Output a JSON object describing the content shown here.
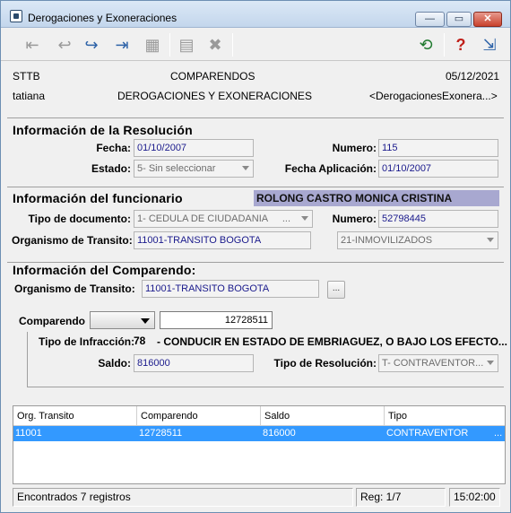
{
  "window": {
    "title": "Derogaciones y Exoneraciones"
  },
  "titlebar": {
    "minimize": "—",
    "maximize": "▭",
    "close": "✕"
  },
  "header": {
    "company": "STTB",
    "module": "COMPARENDOS",
    "date": "05/12/2021",
    "user": "tatiana",
    "form_title": "DEROGACIONES Y EXONERACIONES",
    "form_name": "<DerogacionesExonera...>"
  },
  "resolucion": {
    "title": "Información de la Resolución",
    "fecha_label": "Fecha:",
    "fecha": "01/10/2007",
    "numero_label": "Numero:",
    "numero": "115",
    "estado_label": "Estado:",
    "estado": "5- Sin seleccionar",
    "fecha_aplicacion_label": "Fecha Aplicación:",
    "fecha_aplicacion": "01/10/2007"
  },
  "funcionario": {
    "title": "Información del funcionario",
    "nombre": "ROLONG CASTRO MONICA CRISTINA",
    "tipo_doc_label": "Tipo de documento:",
    "tipo_doc": "1- CEDULA DE CIUDADANIA",
    "tipo_doc_dots": "...",
    "numero_label": "Numero:",
    "numero": "52798445",
    "organismo_label": "Organismo de Transito:",
    "organismo": "11001-TRANSITO BOGOTA",
    "inmovilizados": "21-INMOVILIZADOS"
  },
  "comparendo_info": {
    "title": "Información del Comparendo:",
    "organismo_label": "Organismo de Transito:",
    "organismo": "11001-TRANSITO BOGOTA",
    "lookup_button": "...",
    "comparendo_label": "Comparendo",
    "comparendo_value": "12728511",
    "tipo_infraccion_label": "Tipo de Infracción:",
    "tipo_infraccion_code": "78",
    "tipo_infraccion_desc": "- CONDUCIR EN ESTADO DE EMBRIAGUEZ, O BAJO LOS EFECTO...",
    "saldo_label": "Saldo:",
    "saldo": "816000",
    "tipo_resolucion_label": "Tipo de Resolución:",
    "tipo_resolucion": "T- CONTRAVENTOR..."
  },
  "grid": {
    "columns": [
      "Org. Transito",
      "Comparendo",
      "Saldo",
      "Tipo"
    ],
    "rows": [
      {
        "org": "11001",
        "comparendo": "12728511",
        "saldo": "816000",
        "tipo": "CONTRAVENTOR",
        "more": "..."
      }
    ]
  },
  "status": {
    "records": "Encontrados 7 registros",
    "reg": "Reg: 1/7",
    "time": "15:02:00"
  },
  "colors": {
    "selection": "#3399ff",
    "field_value": "#1a1a8c",
    "funcionario_highlight": "#a8a8d0"
  },
  "icons": {
    "toolbar": [
      "first-record-icon",
      "previous-record-icon",
      "next-record-icon",
      "last-record-icon",
      "edit-icon",
      "save-icon",
      "delete-icon",
      "refresh-icon",
      "help-icon",
      "exit-icon"
    ]
  }
}
